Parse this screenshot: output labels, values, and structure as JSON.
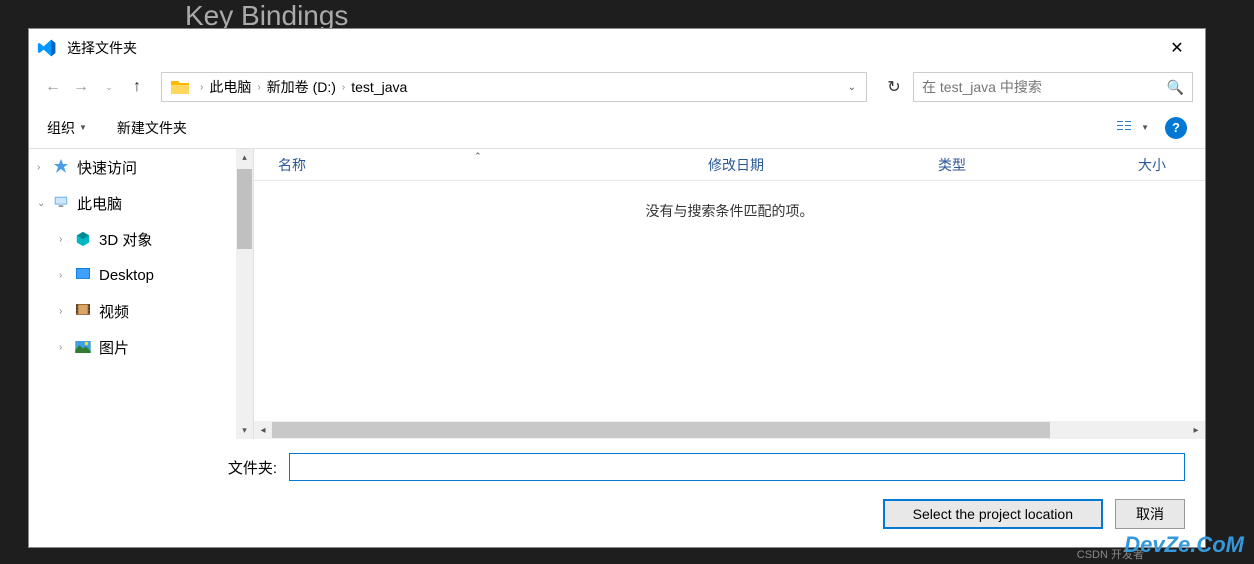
{
  "background_text": "Key Bindings",
  "dialog": {
    "title": "选择文件夹"
  },
  "breadcrumb": {
    "items": [
      "此电脑",
      "新加卷 (D:)",
      "test_java"
    ]
  },
  "search": {
    "placeholder": "在 test_java 中搜索"
  },
  "toolbar": {
    "organize": "组织",
    "new_folder": "新建文件夹"
  },
  "sidebar": {
    "quick_access": "快速访问",
    "this_pc": "此电脑",
    "items": [
      {
        "label": "3D 对象"
      },
      {
        "label": "Desktop"
      },
      {
        "label": "视频"
      },
      {
        "label": "图片"
      }
    ]
  },
  "columns": {
    "name": "名称",
    "date": "修改日期",
    "type": "类型",
    "size": "大小"
  },
  "empty_message": "没有与搜索条件匹配的项。",
  "footer": {
    "folder_label": "文件夹:",
    "select_btn": "Select the project location",
    "cancel_btn": "取消"
  },
  "watermark": "DevZe.CoM",
  "watermark2": "CSDN 开发者"
}
